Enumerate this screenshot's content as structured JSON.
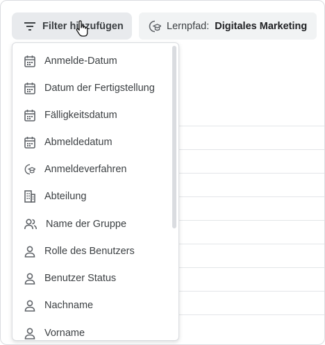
{
  "toolbar": {
    "filter_button_label": "Filter hinzufügen",
    "path_label": "Lernpfad:",
    "path_value": "Digitales Marketing"
  },
  "dropdown": {
    "items": [
      {
        "label": "Anmelde-Datum",
        "icon": "calendar-icon"
      },
      {
        "label": "Datum der Fertigstellung",
        "icon": "calendar-icon"
      },
      {
        "label": "Fälligkeitsdatum",
        "icon": "calendar-icon"
      },
      {
        "label": "Abmeldedatum",
        "icon": "calendar-icon"
      },
      {
        "label": "Anmeldeverfahren",
        "icon": "learning-path-icon"
      },
      {
        "label": "Abteilung",
        "icon": "building-icon"
      },
      {
        "label": "Name der Gruppe",
        "icon": "group-icon"
      },
      {
        "label": "Rolle des Benutzers",
        "icon": "user-icon"
      },
      {
        "label": "Benutzer Status",
        "icon": "user-icon"
      },
      {
        "label": "Nachname",
        "icon": "user-icon"
      },
      {
        "label": "Vorname",
        "icon": "user-icon"
      }
    ]
  },
  "colors": {
    "filter_button_bg": "#e8eaed",
    "path_button_bg": "#f1f3f4",
    "icon_gray": "#5f6368",
    "text": "#3c4043"
  }
}
